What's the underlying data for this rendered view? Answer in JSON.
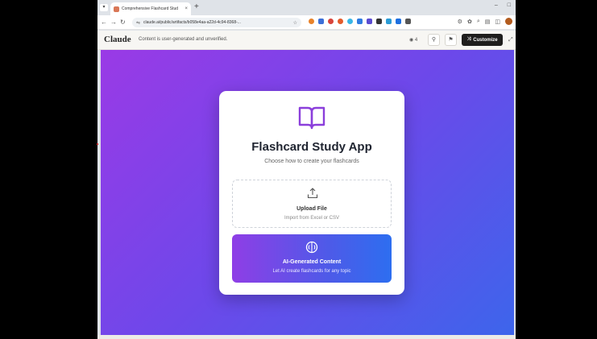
{
  "browser": {
    "tab_title": "Comprehensive Flashcard Stud",
    "tab_close": "×",
    "new_tab": "+",
    "url": "claude.ai/public/artifacts/b058e4aa-a22d-4c94-8368-...",
    "window_minimize": "–",
    "window_maximize": "□"
  },
  "claude_header": {
    "logo": "Claude",
    "notice": "Content is user-generated and unverified.",
    "view_count": "4",
    "customize_label": "Customize"
  },
  "app": {
    "title": "Flashcard Study App",
    "subtitle": "Choose how to create your flashcards",
    "upload": {
      "label": "Upload File",
      "description": "Import from Excel or CSV"
    },
    "ai": {
      "label": "AI-Generated Content",
      "description": "Let AI create flashcards for any topic"
    }
  },
  "colors": {
    "gradient_start": "#9a3ae6",
    "gradient_end": "#3d65eb",
    "accent": "#8b3fdb"
  },
  "icons": [
    "back-icon",
    "forward-icon",
    "reload-icon",
    "book-icon",
    "upload-icon",
    "brain-icon",
    "link-icon",
    "flag-icon"
  ]
}
